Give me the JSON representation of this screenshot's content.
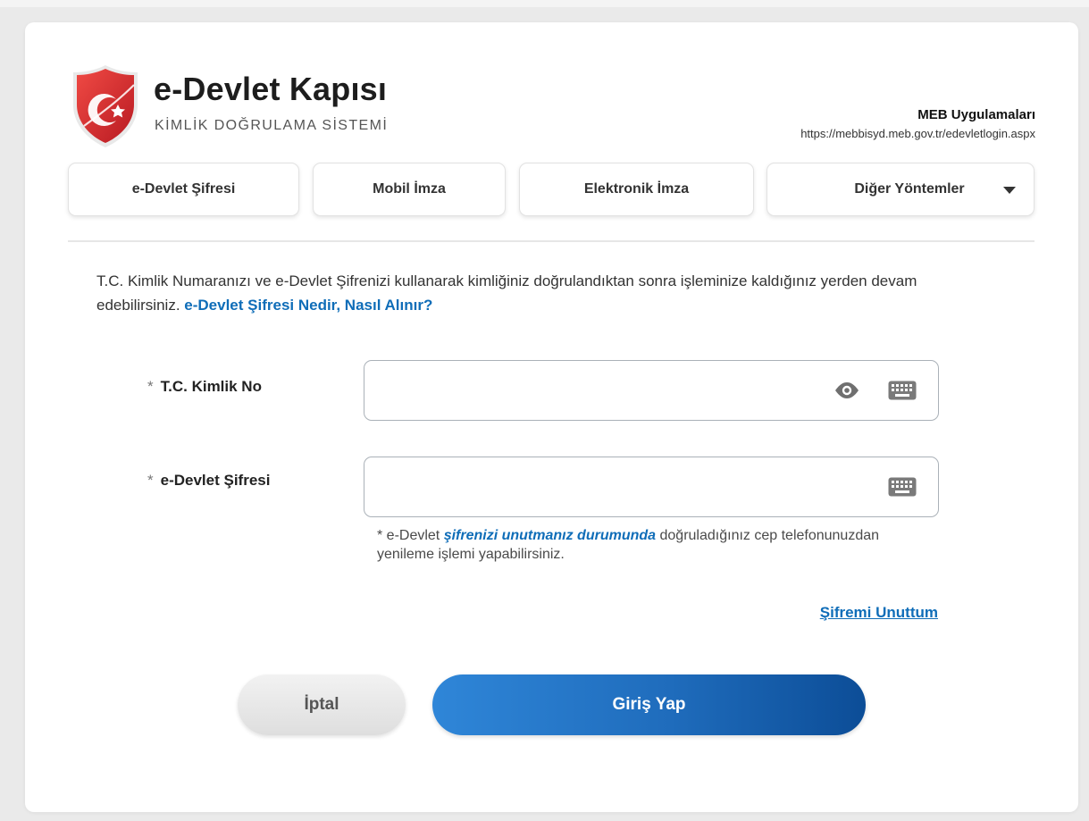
{
  "brand": {
    "title": "e-Devlet Kapısı",
    "subtitle": "KİMLİK DOĞRULAMA SİSTEMİ",
    "logo_icon": "e-devlet-shield-logo"
  },
  "app": {
    "name": "MEB Uygulamaları",
    "url": "https://mebbisyd.meb.gov.tr/edevletlogin.aspx"
  },
  "tabs": [
    {
      "label": "e-Devlet Şifresi",
      "active": true
    },
    {
      "label": "Mobil İmza"
    },
    {
      "label": "Elektronik İmza"
    },
    {
      "label": "Diğer Yöntemler",
      "icon": "chevron-down-icon"
    }
  ],
  "intro": {
    "text": "T.C. Kimlik Numaranızı ve e-Devlet Şifrenizi kullanarak kimliğiniz doğrulandıktan sonra işleminize kaldığınız yerden devam edebilirsiniz.",
    "link": "e-Devlet Şifresi Nedir, Nasıl Alınır?"
  },
  "form": {
    "required_mark": "*",
    "tc_label": "T.C. Kimlik No",
    "tc_value": "",
    "password_label": "e-Devlet Şifresi",
    "password_value": "",
    "hint_prefix": "* e-Devlet",
    "hint_link": "şifrenizi unutmanız durumunda",
    "hint_suffix": "doğruladığınız cep telefonunuzdan yenileme işlemi yapabilirsiniz.",
    "forgot_link": "Şifremi Unuttum"
  },
  "buttons": {
    "cancel": "İptal",
    "login": "Giriş Yap"
  },
  "colors": {
    "brand_red": "#d8262c",
    "link_blue": "#0f6db8",
    "login_gradient_start": "#2f86d8",
    "login_gradient_end": "#0c4d97"
  }
}
